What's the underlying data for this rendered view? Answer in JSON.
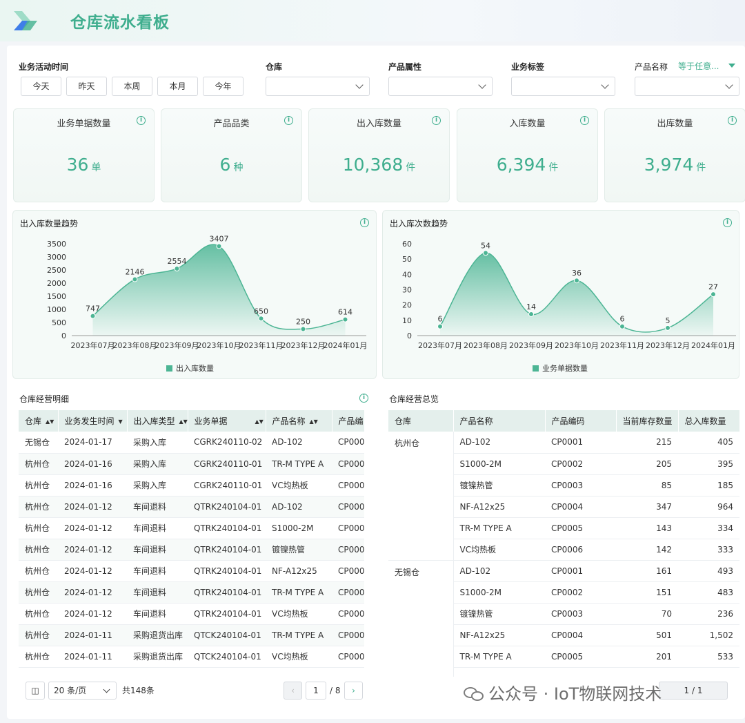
{
  "header": {
    "title": "仓库流水看板"
  },
  "filters": {
    "time_label": "业务活动时间",
    "date_buttons": [
      "今天",
      "昨天",
      "本周",
      "本月",
      "今年"
    ],
    "warehouse_label": "仓库",
    "attr_label": "产品属性",
    "tag_label": "业务标签",
    "product_label": "产品名称",
    "product_operator": "等于任意..."
  },
  "kpis": [
    {
      "title": "业务单据数量",
      "value": "36",
      "unit": "单"
    },
    {
      "title": "产品品类",
      "value": "6",
      "unit": "种"
    },
    {
      "title": "出入库数量",
      "value": "10,368",
      "unit": "件"
    },
    {
      "title": "入库数量",
      "value": "6,394",
      "unit": "件"
    },
    {
      "title": "出库数量",
      "value": "3,974",
      "unit": "件"
    }
  ],
  "chart_data": [
    {
      "type": "area",
      "title": "出入库数量趋势",
      "categories": [
        "2023年07月",
        "2023年08月",
        "2023年09月",
        "2023年10月",
        "2023年11月",
        "2023年12月",
        "2024年01月"
      ],
      "series": [
        {
          "name": "出入库数量",
          "values": [
            747,
            2146,
            2554,
            3407,
            650,
            250,
            614
          ]
        }
      ],
      "yticks": [
        0,
        500,
        1000,
        1500,
        2000,
        2500,
        3000,
        3500
      ],
      "ylim": [
        0,
        3500
      ],
      "color": "#4cb594",
      "legend": "bottom-center"
    },
    {
      "type": "area",
      "title": "出入库次数趋势",
      "categories": [
        "2023年07月",
        "2023年08月",
        "2023年09月",
        "2023年10月",
        "2023年11月",
        "2023年12月",
        "2024年01月"
      ],
      "series": [
        {
          "name": "业务单据数量",
          "values": [
            6,
            54,
            14,
            36,
            6,
            5,
            27
          ]
        }
      ],
      "yticks": [
        0,
        10,
        20,
        30,
        40,
        50,
        60
      ],
      "ylim": [
        0,
        60
      ],
      "color": "#4cb594",
      "legend": "bottom-center"
    }
  ],
  "detail": {
    "title": "仓库经营明细",
    "columns": [
      "仓库",
      "业务发生时间",
      "出入库类型",
      "业务单据",
      "产品名称",
      "产品编"
    ],
    "rows": [
      [
        "无锡仓",
        "2024-01-17",
        "采购入库",
        "CGRK240110-02",
        "AD-102",
        "CP000"
      ],
      [
        "杭州仓",
        "2024-01-16",
        "采购入库",
        "CGRK240110-01",
        "TR-M TYPE A",
        "CP000"
      ],
      [
        "杭州仓",
        "2024-01-16",
        "采购入库",
        "CGRK240110-01",
        "VC均热板",
        "CP000"
      ],
      [
        "杭州仓",
        "2024-01-12",
        "车间退料",
        "QTRK240104-01",
        "AD-102",
        "CP000"
      ],
      [
        "杭州仓",
        "2024-01-12",
        "车间退料",
        "QTRK240104-01",
        "S1000-2M",
        "CP000"
      ],
      [
        "杭州仓",
        "2024-01-12",
        "车间退料",
        "QTRK240104-01",
        "镀镍热管",
        "CP000"
      ],
      [
        "杭州仓",
        "2024-01-12",
        "车间退料",
        "QTRK240104-01",
        "NF-A12x25",
        "CP000"
      ],
      [
        "杭州仓",
        "2024-01-12",
        "车间退料",
        "QTRK240104-01",
        "TR-M TYPE A",
        "CP000"
      ],
      [
        "杭州仓",
        "2024-01-12",
        "车间退料",
        "QTRK240104-01",
        "VC均热板",
        "CP000"
      ],
      [
        "杭州仓",
        "2024-01-11",
        "采购退货出库",
        "QTCK240104-01",
        "TR-M TYPE A",
        "CP000"
      ],
      [
        "杭州仓",
        "2024-01-11",
        "采购退货出库",
        "QTCK240104-01",
        "VC均热板",
        "CP000"
      ]
    ],
    "page_size": "20 条/页",
    "total": "共148条",
    "page": "1",
    "pages": "/ 8"
  },
  "overview": {
    "title": "仓库经营总览",
    "columns": [
      "仓库",
      "产品名称",
      "产品编码",
      "当前库存数量",
      "总入库数量"
    ],
    "groups": [
      {
        "warehouse": "杭州仓",
        "rows": [
          [
            "AD-102",
            "CP0001",
            "215",
            "405"
          ],
          [
            "S1000-2M",
            "CP0002",
            "205",
            "395"
          ],
          [
            "镀镍热管",
            "CP0003",
            "85",
            "185"
          ],
          [
            "NF-A12x25",
            "CP0004",
            "347",
            "964"
          ],
          [
            "TR-M TYPE A",
            "CP0005",
            "143",
            "334"
          ],
          [
            "VC均热板",
            "CP0006",
            "142",
            "333"
          ]
        ]
      },
      {
        "warehouse": "无锡仓",
        "rows": [
          [
            "AD-102",
            "CP0001",
            "161",
            "493"
          ],
          [
            "S1000-2M",
            "CP0002",
            "151",
            "483"
          ],
          [
            "镀镍热管",
            "CP0003",
            "70",
            "236"
          ],
          [
            "NF-A12x25",
            "CP0004",
            "501",
            "1,502"
          ],
          [
            "TR-M TYPE A",
            "CP0005",
            "201",
            "533"
          ]
        ]
      }
    ],
    "page": "1 / 1"
  },
  "watermark": "公众号 · IoT物联网技术"
}
